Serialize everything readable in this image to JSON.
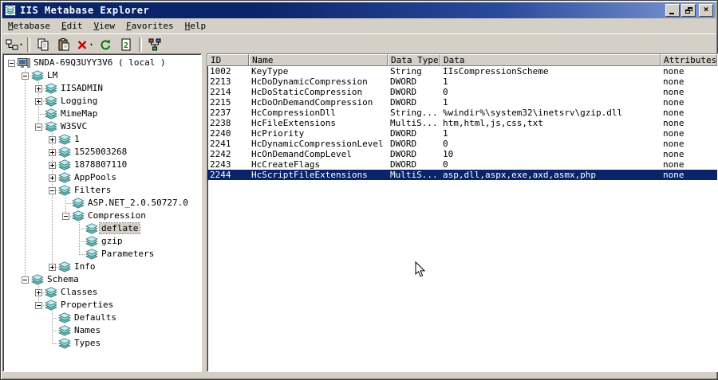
{
  "window": {
    "title": "IIS Metabase Explorer",
    "controls": [
      {
        "name": "minimize-button",
        "glyph": "minimize"
      },
      {
        "name": "restore-button",
        "glyph": "restore"
      },
      {
        "name": "close-button",
        "glyph": "close"
      }
    ]
  },
  "menu": {
    "items": [
      {
        "label": "Metabase",
        "underline": 0
      },
      {
        "label": "Edit",
        "underline": 0
      },
      {
        "label": "View",
        "underline": 0
      },
      {
        "label": "Favorites",
        "underline": 0
      },
      {
        "label": "Help",
        "underline": 0
      }
    ]
  },
  "toolbar": {
    "buttons": [
      {
        "type": "button",
        "icon": "connect-icon",
        "name": "connect-button",
        "dropdown": true
      },
      {
        "type": "separator"
      },
      {
        "type": "button",
        "icon": "copy-icon",
        "name": "copy-button"
      },
      {
        "type": "button",
        "icon": "paste-icon",
        "name": "paste-button"
      },
      {
        "type": "button",
        "icon": "delete-icon",
        "name": "delete-button",
        "dropdown": true
      },
      {
        "type": "button",
        "icon": "refresh-icon",
        "name": "refresh-button"
      },
      {
        "type": "button",
        "icon": "records-icon",
        "name": "records-button"
      },
      {
        "type": "separator"
      },
      {
        "type": "button",
        "icon": "network-icon",
        "name": "network-button"
      }
    ]
  },
  "tree": {
    "items": [
      {
        "label": "SNDA-69Q3UYY3V6 ( local )",
        "level": 0,
        "expander": "minus",
        "icon": "computer-icon",
        "selected": false
      },
      {
        "label": "LM",
        "level": 1,
        "expander": "minus",
        "icon": "db-icon",
        "selected": false
      },
      {
        "label": "IISADMIN",
        "level": 2,
        "expander": "plus",
        "icon": "db-icon",
        "selected": false
      },
      {
        "label": "Logging",
        "level": 2,
        "expander": "plus",
        "icon": "db-icon",
        "selected": false
      },
      {
        "label": "MimeMap",
        "level": 2,
        "expander": "none",
        "icon": "db-icon",
        "selected": false
      },
      {
        "label": "W3SVC",
        "level": 2,
        "expander": "minus",
        "icon": "db-icon",
        "selected": false
      },
      {
        "label": "1",
        "level": 3,
        "expander": "plus",
        "icon": "db-icon",
        "selected": false
      },
      {
        "label": "1525003268",
        "level": 3,
        "expander": "plus",
        "icon": "db-icon",
        "selected": false
      },
      {
        "label": "1878807110",
        "level": 3,
        "expander": "plus",
        "icon": "db-icon",
        "selected": false
      },
      {
        "label": "AppPools",
        "level": 3,
        "expander": "plus",
        "icon": "db-icon",
        "selected": false
      },
      {
        "label": "Filters",
        "level": 3,
        "expander": "minus",
        "icon": "db-icon",
        "selected": false
      },
      {
        "label": "ASP.NET_2.0.50727.0",
        "level": 4,
        "expander": "none",
        "icon": "db-icon",
        "selected": false
      },
      {
        "label": "Compression",
        "level": 4,
        "expander": "minus",
        "icon": "db-icon",
        "selected": false
      },
      {
        "label": "deflate",
        "level": 5,
        "expander": "none",
        "icon": "db-icon",
        "selected": true
      },
      {
        "label": "gzip",
        "level": 5,
        "expander": "none",
        "icon": "db-icon",
        "selected": false
      },
      {
        "label": "Parameters",
        "level": 5,
        "expander": "none",
        "icon": "db-icon",
        "selected": false
      },
      {
        "label": "Info",
        "level": 3,
        "expander": "plus",
        "icon": "db-icon",
        "selected": false
      },
      {
        "label": "Schema",
        "level": 1,
        "expander": "minus",
        "icon": "db-icon",
        "selected": false
      },
      {
        "label": "Classes",
        "level": 2,
        "expander": "plus",
        "icon": "db-icon",
        "selected": false
      },
      {
        "label": "Properties",
        "level": 2,
        "expander": "minus",
        "icon": "db-icon",
        "selected": false
      },
      {
        "label": "Defaults",
        "level": 3,
        "expander": "none",
        "icon": "db-icon",
        "selected": false
      },
      {
        "label": "Names",
        "level": 3,
        "expander": "none",
        "icon": "db-icon",
        "selected": false
      },
      {
        "label": "Types",
        "level": 3,
        "expander": "none",
        "icon": "db-icon",
        "selected": false
      }
    ]
  },
  "table": {
    "columns": [
      "ID",
      "Name",
      "Data Type",
      "Data",
      "Attributes"
    ],
    "rows": [
      {
        "id": "1002",
        "name": "KeyType",
        "data_type": "String",
        "data": "IIsCompressionScheme",
        "attributes": "none",
        "selected": false
      },
      {
        "id": "2213",
        "name": "HcDoDynamicCompression",
        "data_type": "DWORD",
        "data": "1",
        "attributes": "none",
        "selected": false
      },
      {
        "id": "2214",
        "name": "HcDoStaticCompression",
        "data_type": "DWORD",
        "data": "0",
        "attributes": "none",
        "selected": false
      },
      {
        "id": "2215",
        "name": "HcDoOnDemandCompression",
        "data_type": "DWORD",
        "data": "1",
        "attributes": "none",
        "selected": false
      },
      {
        "id": "2237",
        "name": "HcCompressionDll",
        "data_type": "String...",
        "data": "%windir%\\system32\\inetsrv\\gzip.dll",
        "attributes": "none",
        "selected": false
      },
      {
        "id": "2238",
        "name": "HcFileExtensions",
        "data_type": "MultiS...",
        "data": "htm,html,js,css,txt",
        "attributes": "none",
        "selected": false
      },
      {
        "id": "2240",
        "name": "HcPriority",
        "data_type": "DWORD",
        "data": "1",
        "attributes": "none",
        "selected": false
      },
      {
        "id": "2241",
        "name": "HcDynamicCompressionLevel",
        "data_type": "DWORD",
        "data": "0",
        "attributes": "none",
        "selected": false
      },
      {
        "id": "2242",
        "name": "HcOnDemandCompLevel",
        "data_type": "DWORD",
        "data": "10",
        "attributes": "none",
        "selected": false
      },
      {
        "id": "2243",
        "name": "HcCreateFlags",
        "data_type": "DWORD",
        "data": "0",
        "attributes": "none",
        "selected": false
      },
      {
        "id": "2244",
        "name": "HcScriptFileExtensions",
        "data_type": "MultiS...",
        "data": "asp,dll,aspx,exe,axd,asmx,php",
        "attributes": "none",
        "selected": true
      }
    ]
  },
  "colors": {
    "titlebar_start": "#0a246a",
    "titlebar_end": "#7f9bd6",
    "selection": "#0a246a",
    "chrome": "#d4d0c8"
  }
}
